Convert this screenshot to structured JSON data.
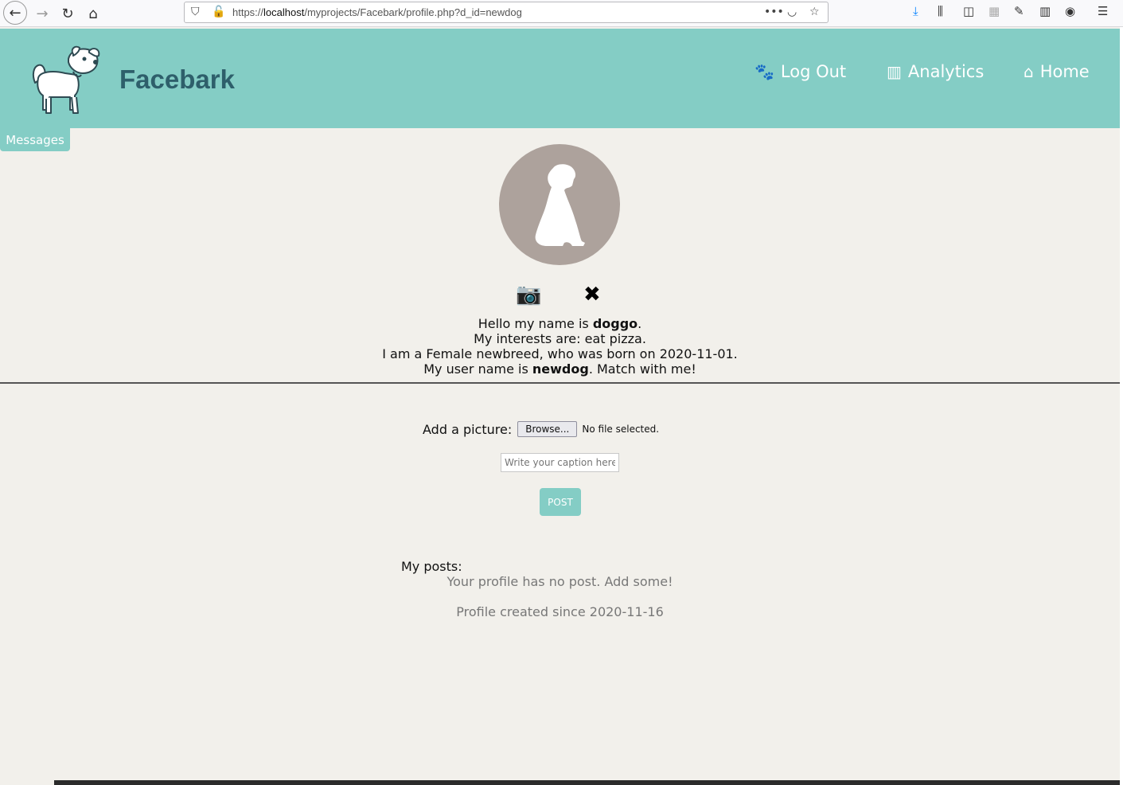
{
  "browser": {
    "url_prefix": "https://",
    "url_host": "localhost",
    "url_path": "/myprojects/Facebark/profile.php?d_id=newdog"
  },
  "header": {
    "brand": "Facebark",
    "nav": [
      {
        "label": "Log Out",
        "icon": "paw-icon"
      },
      {
        "label": "Analytics",
        "icon": "analytics-icon"
      },
      {
        "label": "Home",
        "icon": "home-icon"
      }
    ],
    "messages_tab": "Messages"
  },
  "profile": {
    "line1_pre": "Hello my name is ",
    "name": "doggo",
    "line1_post": ".",
    "line2": "My interests are: eat pizza.",
    "line3": "I am a Female newbreed, who was born on 2020-11-01.",
    "line4_pre": "My user name is ",
    "username": "newdog",
    "line4_post": ". Match with me!"
  },
  "upload": {
    "label": "Add a picture:",
    "browse": "Browse...",
    "no_file": "No file selected.",
    "caption_placeholder": "Write your caption here..",
    "post": "POST"
  },
  "posts": {
    "label": "My posts:",
    "empty": "Your profile has no post. Add some!",
    "created": "Profile created since 2020-11-16"
  },
  "colors": {
    "accent": "#84cdc5",
    "brand_text": "#2e5f6b",
    "avatar_bg": "#ada29c",
    "background": "#f2f0eb"
  }
}
